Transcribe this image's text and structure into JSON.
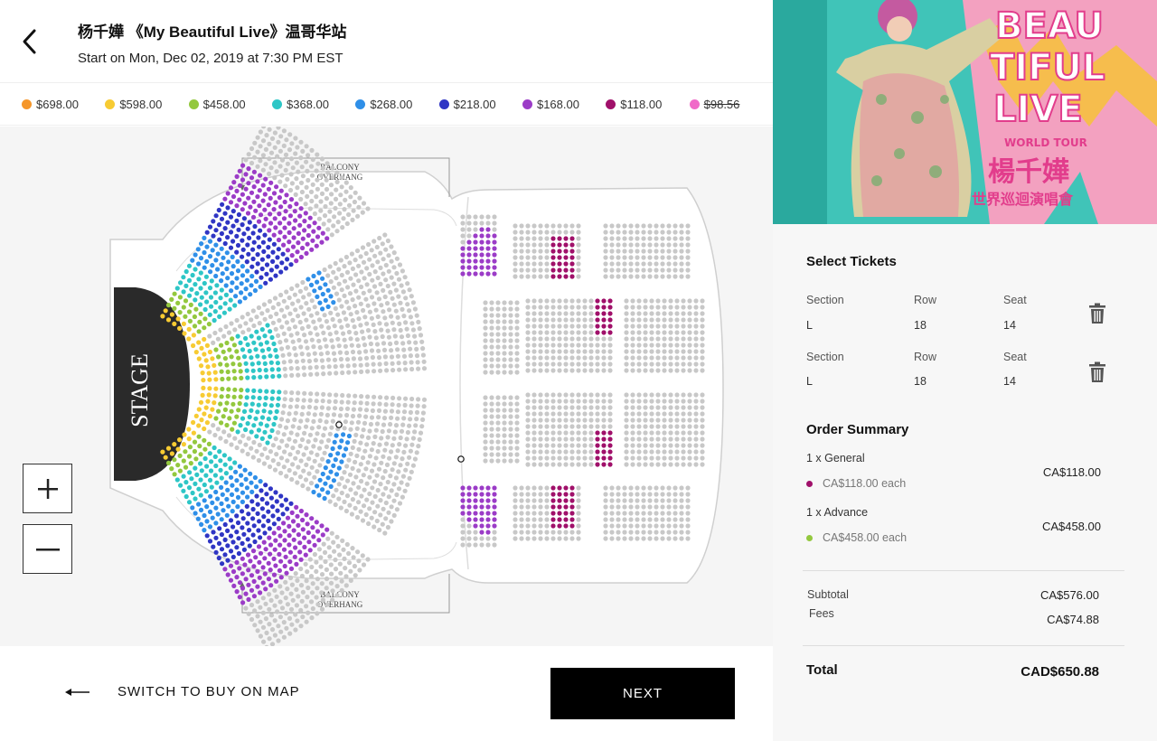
{
  "header": {
    "title": "杨千嬅 《My Beautiful Live》温哥华站",
    "subtitle": "Start on Mon, Dec 02, 2019 at 7:30 PM EST"
  },
  "legend": [
    {
      "label": "$698.00",
      "color": "#f5962a",
      "strike": false
    },
    {
      "label": "$598.00",
      "color": "#f7cb33",
      "strike": false
    },
    {
      "label": "$458.00",
      "color": "#93c83e",
      "strike": false
    },
    {
      "label": "$368.00",
      "color": "#2ec6c6",
      "strike": false
    },
    {
      "label": "$268.00",
      "color": "#2f8fe8",
      "strike": false
    },
    {
      "label": "$218.00",
      "color": "#2f35c4",
      "strike": false
    },
    {
      "label": "$168.00",
      "color": "#9b3cc7",
      "strike": false
    },
    {
      "label": "$118.00",
      "color": "#a0106a",
      "strike": false
    },
    {
      "label": "$98.56",
      "color": "#f06ac8",
      "strike": true
    }
  ],
  "map": {
    "stage_label": "STAGE",
    "balcony_top": [
      "BALCONY",
      "OVERHANG"
    ],
    "balcony_bottom": [
      "BALCONY",
      "OVERHANG"
    ]
  },
  "footer": {
    "switch_label": "SWITCH TO BUY ON MAP",
    "next_label": "NEXT"
  },
  "sidebar": {
    "poster": {
      "title_lines": [
        "BEAU",
        "TIFUL",
        "LIVE"
      ],
      "tour": "WORLD TOUR",
      "artist": "楊千嬅",
      "subtitle": "世界巡迴演唱會"
    },
    "select_title": "Select Tickets",
    "column_labels": {
      "section": "Section",
      "row": "Row",
      "seat": "Seat"
    },
    "tickets": [
      {
        "section": "L",
        "row": "18",
        "seat": "14"
      },
      {
        "section": "L",
        "row": "18",
        "seat": "14"
      }
    ],
    "order_title": "Order Summary",
    "order_lines": [
      {
        "name": "1 x General",
        "each": "CA$118.00 each",
        "price": "CA$118.00",
        "color": "#a0106a"
      },
      {
        "name": "1 x Advance",
        "each": "CA$458.00 each",
        "price": "CA$458.00",
        "color": "#93c83e"
      }
    ],
    "subtotal_label": "Subtotal",
    "subtotal_value": "CA$576.00",
    "fees_label": "Fees",
    "fees_value": "CA$74.88",
    "total_label": "Total",
    "total_value": "CAD$650.88"
  }
}
